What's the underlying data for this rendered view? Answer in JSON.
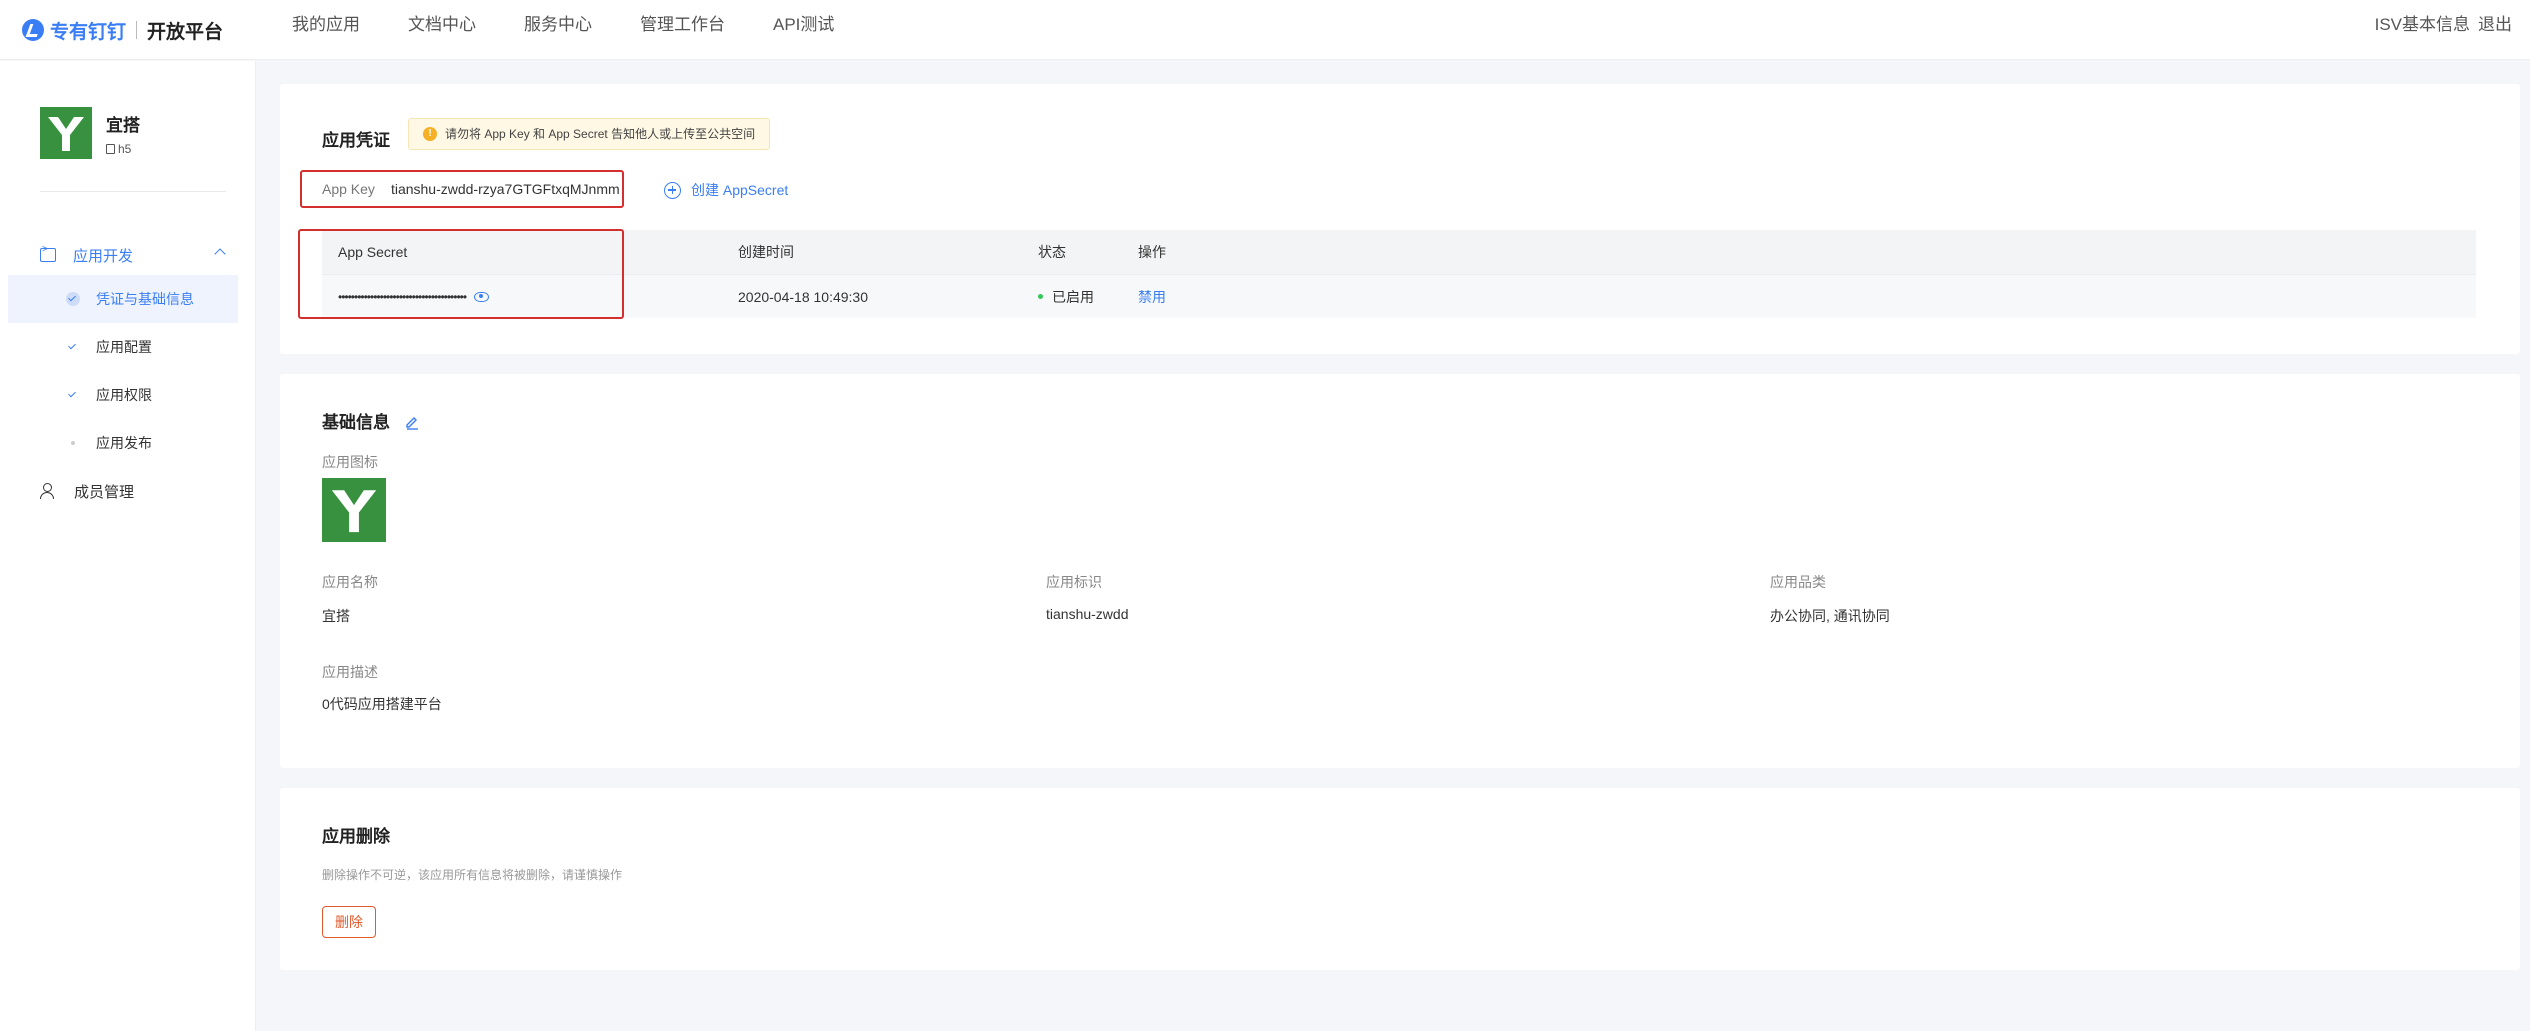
{
  "header": {
    "brand_primary": "专有钉钉",
    "brand_secondary": "开放平台",
    "nav": [
      "我的应用",
      "文档中心",
      "服务中心",
      "管理工作台",
      "API测试"
    ],
    "right": [
      "ISV基本信息",
      "退出"
    ]
  },
  "sidebar": {
    "app_name": "宜搭",
    "app_type": "h5",
    "group_label": "应用开发",
    "items": [
      {
        "label": "凭证与基础信息",
        "state": "active"
      },
      {
        "label": "应用配置",
        "state": "done"
      },
      {
        "label": "应用权限",
        "state": "done"
      },
      {
        "label": "应用发布",
        "state": "pending"
      }
    ],
    "member_label": "成员管理"
  },
  "credentials": {
    "title": "应用凭证",
    "warning": "请勿将 App Key 和 App Secret 告知他人或上传至公共空间",
    "app_key_label": "App Key",
    "app_key_value": "tianshu-zwdd-rzya7GTGFtxqMJnmm",
    "create_secret": "创建 AppSecret",
    "table": {
      "headers": [
        "App Secret",
        "创建时间",
        "状态",
        "操作"
      ],
      "rows": [
        {
          "secret": "••••••••••••••••••••••••••••••••••••••••",
          "created": "2020-04-18 10:49:30",
          "status": "已启用",
          "action": "禁用"
        }
      ]
    }
  },
  "basic_info": {
    "title": "基础信息",
    "icon_label": "应用图标",
    "name_label": "应用名称",
    "name_value": "宜搭",
    "id_label": "应用标识",
    "id_value": "tianshu-zwdd",
    "category_label": "应用品类",
    "category_value": "办公协同, 通讯协同",
    "desc_label": "应用描述",
    "desc_value": "0代码应用搭建平台"
  },
  "deletion": {
    "title": "应用删除",
    "description": "删除操作不可逆，该应用所有信息将被删除，请谨慎操作",
    "button": "删除"
  },
  "colors": {
    "accent": "#3a7ef5",
    "logo_green": "#37913e",
    "danger": "#e05a2b",
    "highlight_box": "#d32f2f"
  }
}
